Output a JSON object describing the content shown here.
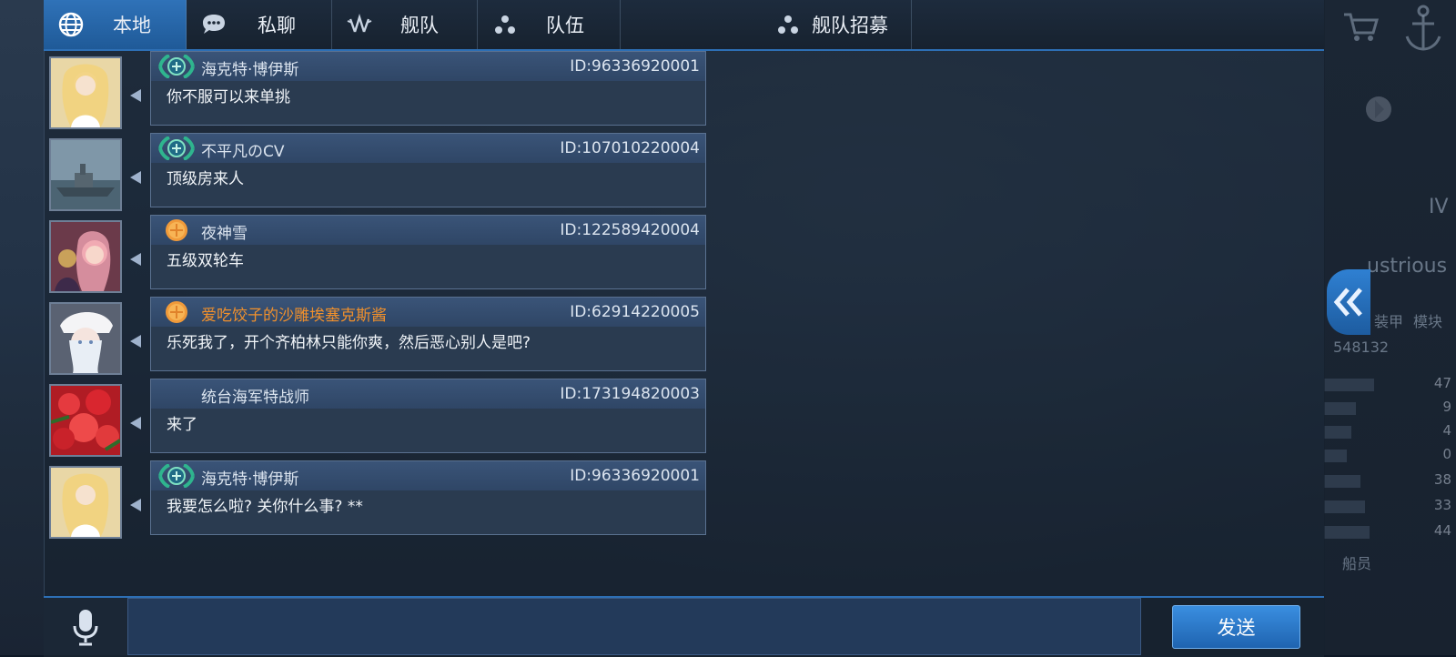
{
  "tabs": [
    {
      "label": "本地",
      "icon": "globe-icon",
      "active": true
    },
    {
      "label": "私聊",
      "icon": "chat-bubble-icon",
      "active": false
    },
    {
      "label": "舰队",
      "icon": "fleet-emblem-icon",
      "active": false
    },
    {
      "label": "队伍",
      "icon": "team-dots-icon",
      "active": false
    },
    {
      "label": "舰队招募",
      "icon": "team-dots-icon",
      "active": false
    }
  ],
  "messages": [
    {
      "name": "海克特·博伊斯",
      "uid": "ID:96336920001",
      "text": "你不服可以来单挑",
      "badge": "vip-wreath-badge",
      "name_color": "#dbe4ef"
    },
    {
      "name": "不平凡のCV",
      "uid": "ID:107010220004",
      "text": "顶级房来人",
      "badge": "vip-wreath-badge",
      "name_color": "#dbe4ef"
    },
    {
      "name": "夜神雪",
      "uid": "ID:122589420004",
      "text": "五级双轮车",
      "badge": "gold-coin-badge",
      "name_color": "#dbe4ef"
    },
    {
      "name": "爱吃饺子的沙雕埃塞克斯酱",
      "uid": "ID:62914220005",
      "text": "乐死我了，开个齐柏林只能你爽，然后恶心别人是吧?",
      "badge": "gold-coin-badge",
      "name_color": "#f0902c"
    },
    {
      "name": "统台海军特战师",
      "uid": "ID:173194820003",
      "text": "来了",
      "badge": "",
      "name_color": "#dbe4ef"
    },
    {
      "name": "海克特·博伊斯",
      "uid": "ID:96336920001",
      "text": "我要怎么啦? 关你什么事? **",
      "badge": "vip-wreath-badge",
      "name_color": "#dbe4ef"
    }
  ],
  "input": {
    "value": "",
    "placeholder": ""
  },
  "send_label": "发送",
  "background": {
    "ship_tier": "IV",
    "ship_name": "ustrious",
    "power": "548132",
    "stats": [
      47,
      9,
      4,
      0,
      38,
      33,
      44
    ],
    "crew_label": "船员",
    "armor_label": "装甲",
    "module_label": "模块"
  },
  "colors": {
    "accent": "#2d6fb5",
    "orange_name": "#f0902c"
  }
}
